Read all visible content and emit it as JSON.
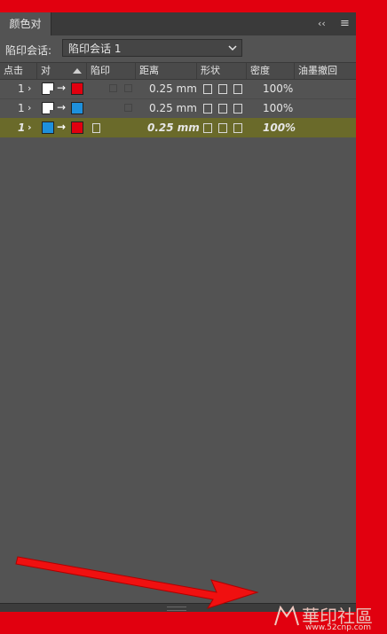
{
  "panel": {
    "tab_title": "颜色对",
    "collapse_label": "‹‹",
    "menu_label": "≡"
  },
  "session": {
    "label": "陷印会话:",
    "selected": "陷印会话 1"
  },
  "columns": [
    "点击",
    "对",
    "陷印",
    "距离",
    "形状",
    "密度",
    "油墨撤回"
  ],
  "rows": [
    {
      "click": "1",
      "from_color": "#ffffff",
      "to_color": "#e1000f",
      "distance": "0.25 mm",
      "density": "100%",
      "selected": false
    },
    {
      "click": "1",
      "from_color": "#ffffff",
      "to_color": "#1e90dc",
      "distance": "0.25 mm",
      "density": "100%",
      "selected": false
    },
    {
      "click": "1",
      "from_color": "#1e90dc",
      "to_color": "#e1000f",
      "distance": "0.25 mm",
      "density": "100%",
      "selected": true
    }
  ],
  "watermark": {
    "text": "華印社區",
    "url": "www.52cnp.com"
  },
  "colors": {
    "background": "#e1000f",
    "panel": "#535353",
    "selected_row": "#6a6a2a"
  }
}
